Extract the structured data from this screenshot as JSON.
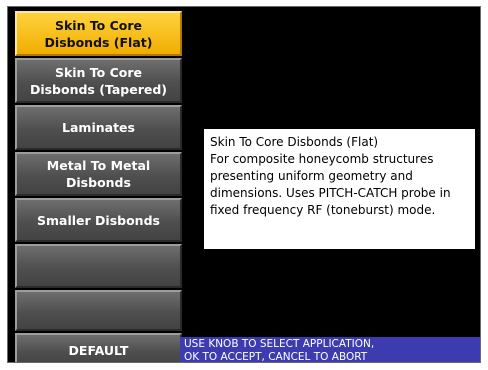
{
  "menu": {
    "items": [
      {
        "line1": "Skin To Core",
        "line2": "Disbonds (Flat)"
      },
      {
        "line1": "Skin To Core",
        "line2": "Disbonds (Tapered)"
      },
      {
        "line1": "Laminates",
        "line2": ""
      },
      {
        "line1": "Metal To Metal",
        "line2": "Disbonds"
      },
      {
        "line1": "Smaller Disbonds",
        "line2": ""
      },
      {
        "line1": "",
        "line2": ""
      },
      {
        "line1": "",
        "line2": ""
      },
      {
        "line1": "DEFAULT",
        "line2": ""
      }
    ],
    "selected_color": "#f5b800"
  },
  "info": {
    "lines": [
      "Skin To Core Disbonds (Flat)",
      "For composite honeycomb structures",
      "presenting uniform geometry and",
      "dimensions. Uses PITCH-CATCH probe in",
      "fixed frequency RF (toneburst) mode."
    ]
  },
  "status": {
    "line1": "USE KNOB TO SELECT APPLICATION,",
    "line2": "OK TO ACCEPT, CANCEL TO ABORT",
    "color": "#3c3cb0"
  }
}
